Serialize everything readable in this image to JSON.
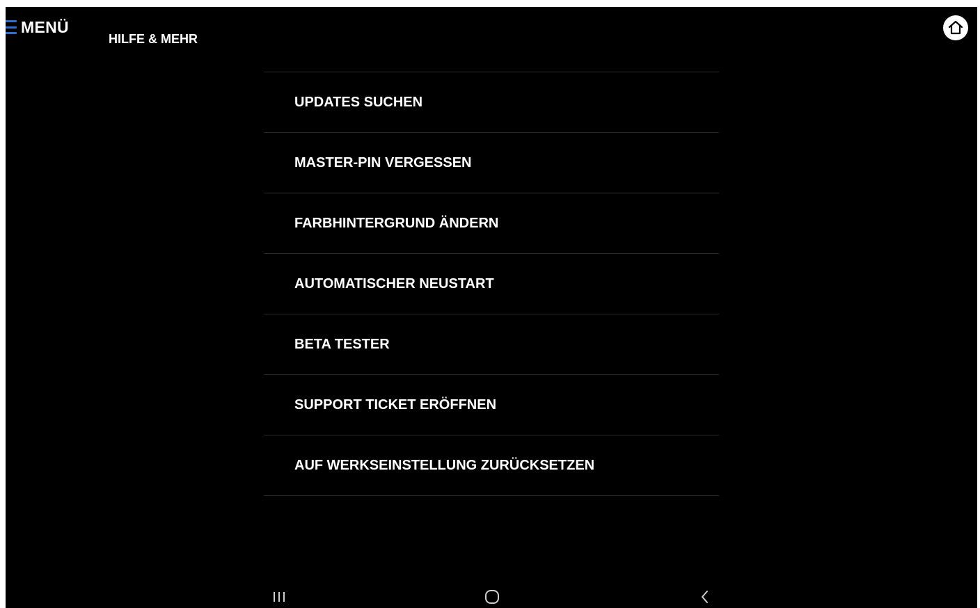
{
  "header": {
    "menu_label": "MENÜ",
    "page_title": "HILFE & MEHR",
    "menu_icon": "hamburger-icon",
    "home_icon": "home-icon"
  },
  "menu": {
    "items": [
      {
        "label": "UPDATES SUCHEN"
      },
      {
        "label": "MASTER-PIN VERGESSEN"
      },
      {
        "label": "FARBHINTERGRUND ÄNDERN"
      },
      {
        "label": "AUTOMATISCHER NEUSTART"
      },
      {
        "label": "BETA TESTER"
      },
      {
        "label": "SUPPORT TICKET ERÖFFNEN"
      },
      {
        "label": "AUF WERKSEINSTELLUNG ZURÜCKSETZEN"
      }
    ]
  },
  "navbar": {
    "recents_icon": "recent-apps-icon",
    "home_icon": "home-circle-icon",
    "back_icon": "back-chevron-icon"
  },
  "colors": {
    "background": "#000000",
    "text": "#ffffff",
    "accent": "#2f6fd0",
    "divider": "#2a2a2a"
  }
}
